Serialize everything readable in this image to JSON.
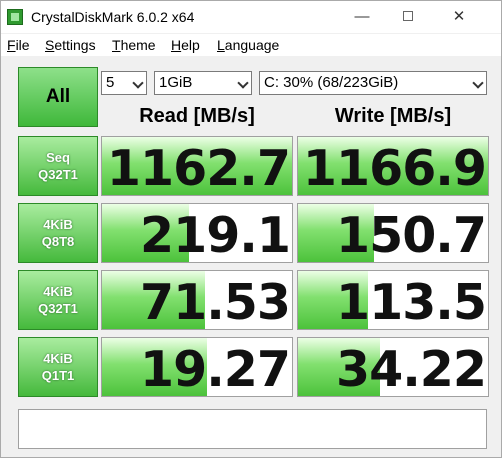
{
  "window": {
    "title": "CrystalDiskMark 6.0.2 x64",
    "controls": {
      "minimize": "—",
      "close": "✕"
    }
  },
  "menu": [
    {
      "label": "File",
      "accel": "F",
      "rest": "ile"
    },
    {
      "label": "Settings",
      "accel": "S",
      "rest": "ettings"
    },
    {
      "label": "Theme",
      "accel": "T",
      "rest": "heme"
    },
    {
      "label": "Help",
      "accel": "H",
      "rest": "elp"
    },
    {
      "label": "Language",
      "accel": "L",
      "rest": "anguage"
    }
  ],
  "toolbar": {
    "all_label": "All",
    "test_count": "5",
    "test_size": "1GiB",
    "drive": "C: 30% (68/223GiB)"
  },
  "columns": {
    "read": "Read [MB/s]",
    "write": "Write [MB/s]"
  },
  "tests": [
    {
      "line1": "Seq",
      "line2": "Q32T1",
      "read": "1162.7",
      "write": "1166.9",
      "read_fill": 1.0,
      "write_fill": 1.0
    },
    {
      "line1": "4KiB",
      "line2": "Q8T8",
      "read": "219.1",
      "write": "150.7",
      "read_fill": 0.46,
      "write_fill": 0.4
    },
    {
      "line1": "4KiB",
      "line2": "Q32T1",
      "read": "71.53",
      "write": "113.5",
      "read_fill": 0.54,
      "write_fill": 0.37
    },
    {
      "line1": "4KiB",
      "line2": "Q1T1",
      "read": "19.27",
      "write": "34.22",
      "read_fill": 0.55,
      "write_fill": 0.43
    }
  ],
  "colors": {
    "accent_green": "#45b93c",
    "bar_green": "#82e06f"
  },
  "status": ""
}
